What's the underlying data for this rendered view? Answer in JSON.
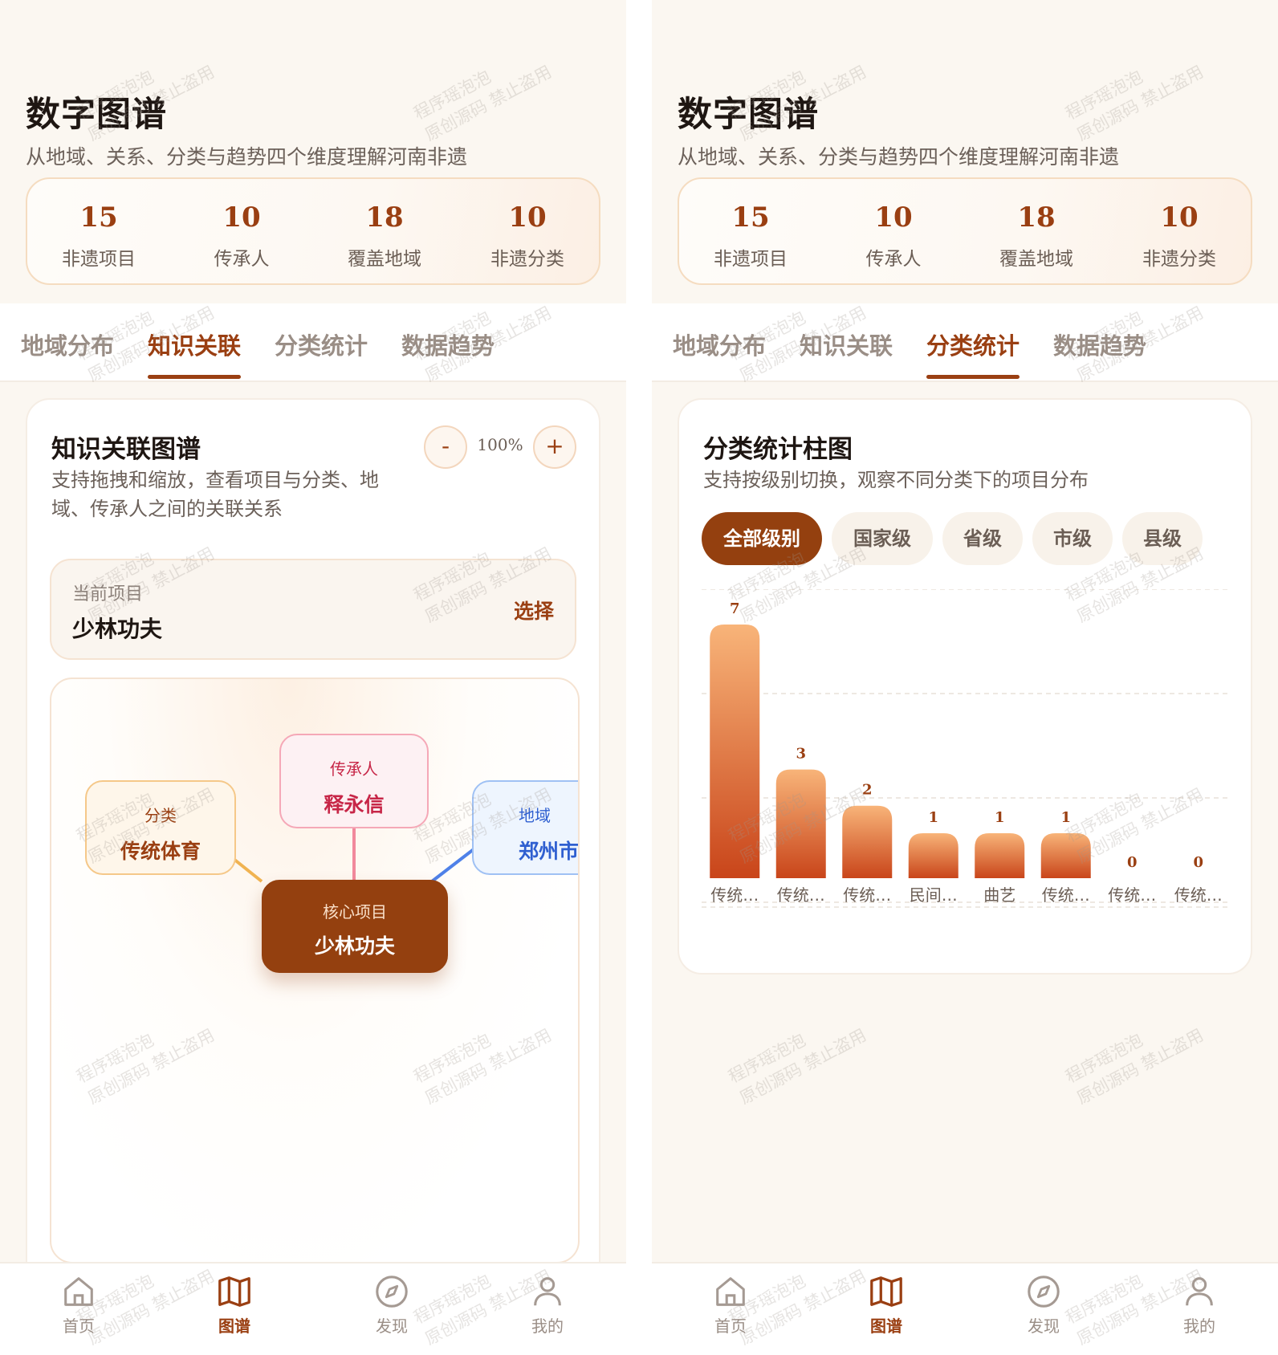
{
  "header": {
    "title": "数字图谱",
    "subtitle": "从地域、关系、分类与趋势四个维度理解河南非遗"
  },
  "stats": [
    {
      "value": "15",
      "label": "非遗项目"
    },
    {
      "value": "10",
      "label": "传承人"
    },
    {
      "value": "18",
      "label": "覆盖地域"
    },
    {
      "value": "10",
      "label": "非遗分类"
    }
  ],
  "tabs": [
    "地域分布",
    "知识关联",
    "分类统计",
    "数据趋势"
  ],
  "left": {
    "active_tab": 1,
    "card_title": "知识关联图谱",
    "card_desc_line1": "支持拖拽和缩放，查看项目与分类、地",
    "card_desc_line2": "域、传承人之间的关联关系",
    "zoom_minus": "-",
    "zoom_level": "100%",
    "zoom_plus": "+",
    "project_label": "当前项目",
    "project_name": "少林功夫",
    "project_select": "选择",
    "graph": {
      "category": {
        "kind": "分类",
        "value": "传统体育",
        "color": "#f0b351"
      },
      "inheritor": {
        "kind": "传承人",
        "value": "释永信",
        "color": "#f2899c"
      },
      "region": {
        "kind": "地域",
        "value": "郑州市",
        "color": "#4f81e8"
      },
      "core": {
        "kind": "核心项目",
        "value": "少林功夫"
      }
    }
  },
  "right": {
    "active_tab": 2,
    "card_title": "分类统计柱图",
    "card_desc": "支持按级别切换，观察不同分类下的项目分布",
    "filters": [
      "全部级别",
      "国家级",
      "省级",
      "市级",
      "县级"
    ],
    "active_filter": 0
  },
  "chart_data": {
    "type": "bar",
    "categories": [
      "传统…",
      "传统…",
      "传统…",
      "民间…",
      "曲艺",
      "传统…",
      "传统…",
      "传统…"
    ],
    "values": [
      7,
      3,
      2,
      1,
      1,
      1,
      0,
      0
    ],
    "ylim": [
      0,
      7
    ],
    "grid": true,
    "bar_gradient": [
      "#f8b479",
      "#c9451a"
    ]
  },
  "tabbar": [
    {
      "label": "首页",
      "icon": "home-icon"
    },
    {
      "label": "图谱",
      "icon": "map-icon"
    },
    {
      "label": "发现",
      "icon": "compass-icon"
    },
    {
      "label": "我的",
      "icon": "user-icon"
    }
  ],
  "tabbar_active": 1,
  "watermark": {
    "line1": "程序瑶泡泡",
    "line2": "原创源码 禁止盗用"
  },
  "colors": {
    "accent": "#9a3f12",
    "background": "#fbf7f1"
  }
}
